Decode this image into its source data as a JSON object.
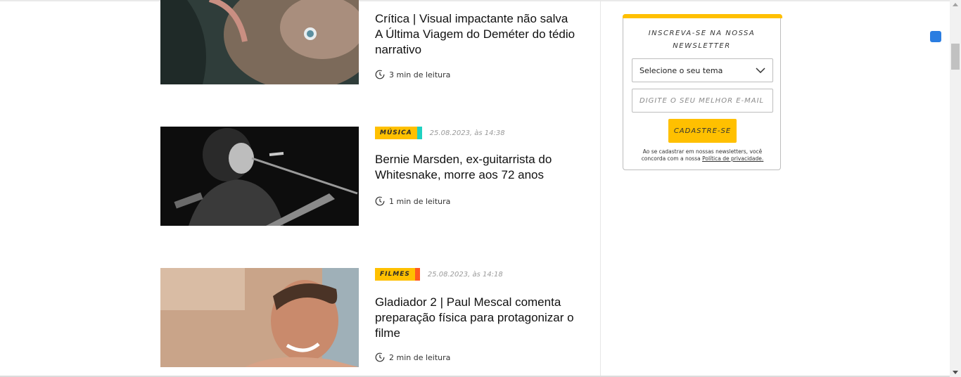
{
  "articles": [
    {
      "title": "Crítica | Visual impactante não salva A Última Viagem do Deméter do tédio narrativo",
      "read_time": "3 min de leitura",
      "image": "creature-close-up"
    },
    {
      "tag": "MÚSICA",
      "tag_edge_color": "#1fd1c1",
      "date": "25.08.2023, às 14:38",
      "title": "Bernie Marsden, ex-guitarrista do Whitesnake, morre aos 72 anos",
      "read_time": "1 min de leitura",
      "image": "guitarist-black-and-white"
    },
    {
      "tag": "FILMES",
      "tag_edge_color": "#ff5a1f",
      "date": "25.08.2023, às 14:18",
      "title": "Gladiador 2 | Paul Mescal comenta preparação física para protagonizar o filme",
      "read_time": "2 min de leitura",
      "image": "smiling-actor"
    }
  ],
  "newsletter": {
    "title": "INSCREVA-SE NA NOSSA NEWSLETTER",
    "select_value": "Selecione o seu tema",
    "email_placeholder": "DIGITE O SEU MELHOR E-MAIL",
    "button_label": "CADASTRE-SE",
    "consent_text": "Ao se cadastrar em nossas newsletters, você concorda com a nossa",
    "privacy_link": "Política de privacidade",
    "accent_color": "#ffc000"
  }
}
